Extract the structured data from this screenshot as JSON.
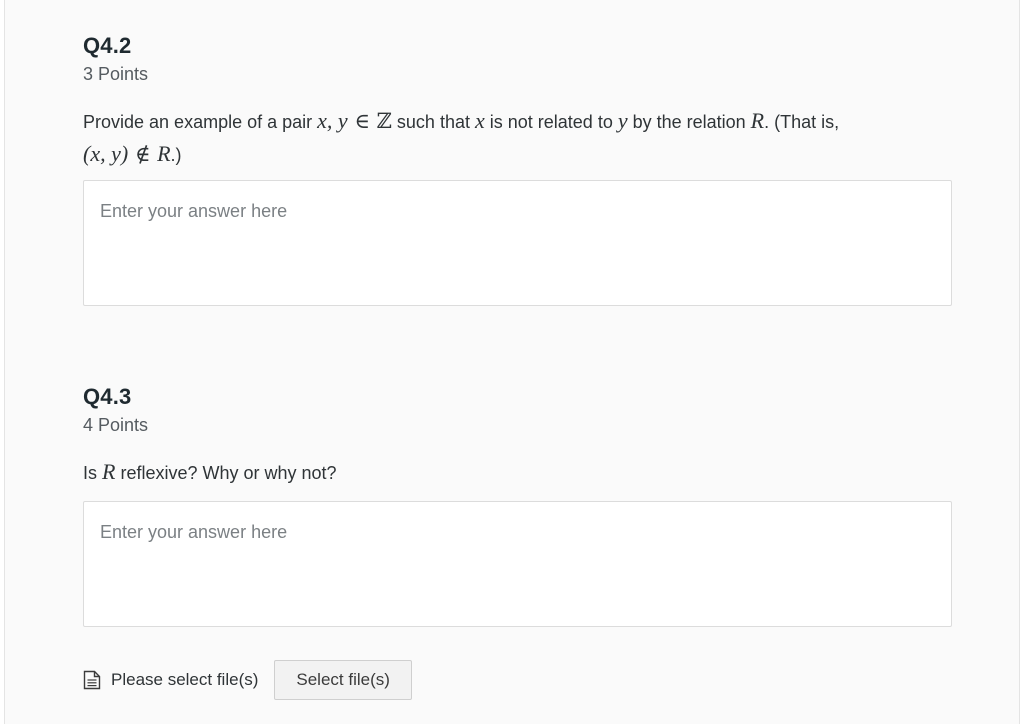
{
  "questions": [
    {
      "title": "Q4.2",
      "points": "3 Points",
      "prompt": {
        "t1": "Provide an example of a pair ",
        "m1": "x, y",
        "m2": " ∈ ",
        "m3": "ℤ",
        "t2": " such that ",
        "m4": "x",
        "t3": " is not related to ",
        "m5": "y",
        "t4": " by the relation ",
        "m6": "R",
        "t5": ". (That is,",
        "m7": "(x, y)",
        "m8": " ∉ ",
        "m9": "R",
        "t6": ".)"
      },
      "answer_placeholder": "Enter your answer here"
    },
    {
      "title": "Q4.3",
      "points": "4 Points",
      "prompt": {
        "t1": "Is ",
        "m1": "R",
        "t2": " reflexive? Why or why not?"
      },
      "answer_placeholder": "Enter your answer here"
    }
  ],
  "file_upload": {
    "icon": "document-icon",
    "label": "Please select file(s)",
    "button_label": "Select file(s)"
  }
}
